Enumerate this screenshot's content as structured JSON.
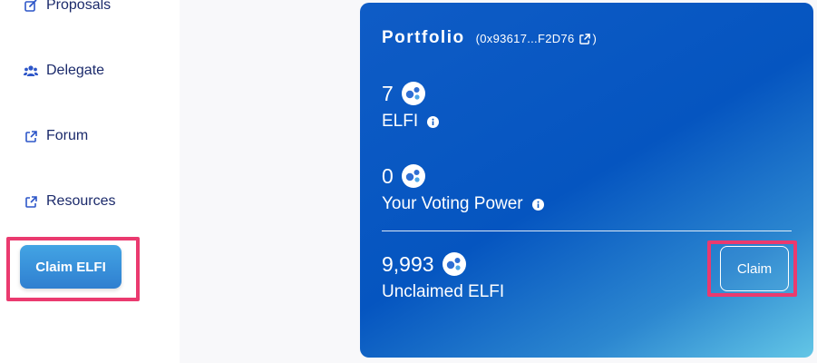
{
  "sidebar": {
    "items": [
      {
        "label": "Proposals",
        "icon": "edit-icon"
      },
      {
        "label": "Delegate",
        "icon": "users-icon"
      },
      {
        "label": "Forum",
        "icon": "external-link-icon"
      },
      {
        "label": "Resources",
        "icon": "external-link-icon"
      }
    ],
    "claim_button": "Claim ELFI"
  },
  "portfolio": {
    "title": "Portfolio",
    "address_open": "(0x93617...F2D76",
    "address_close": ")",
    "elfi": {
      "value": "7",
      "label": "ELFI"
    },
    "voting_power": {
      "value": "0",
      "label": "Your Voting Power"
    },
    "unclaimed": {
      "value": "9,993",
      "label": "Unclaimed ELFI"
    },
    "claim_button": "Claim"
  },
  "colors": {
    "nav_text": "#1b2a6b",
    "highlight": "#ea3a6f",
    "card_blue": "#0555c0",
    "card_cyan": "#63c6e6",
    "button_blue": "#2f7fd0"
  }
}
